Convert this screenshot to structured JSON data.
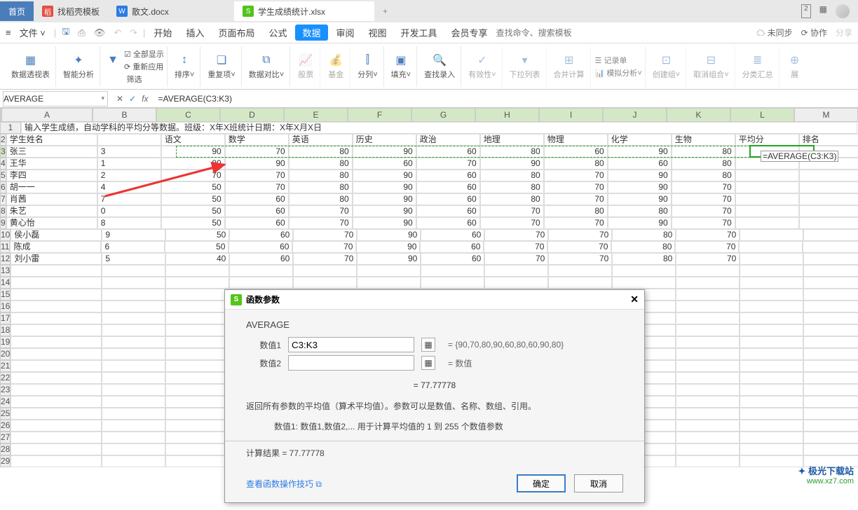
{
  "tabs": {
    "home": "首页",
    "t1": "找稻壳模板",
    "t2": "散文.docx",
    "t3": "学生成绩统计.xlsx"
  },
  "tab_right_square": "2",
  "file_btn": "文件",
  "menu": {
    "kaishi": "开始",
    "charu": "插入",
    "yemian": "页面布局",
    "gongshi": "公式",
    "shuju": "数据",
    "shenyue": "审阅",
    "shitu": "视图",
    "kaifa": "开发工具",
    "huiyuan": "会员专享"
  },
  "search_placeholder": "查找命令、搜索模板",
  "menu_right": {
    "weitongbu": "未同步",
    "xiezuo": "协作",
    "fenxiang": "分享"
  },
  "ribbon": {
    "shujutoushi": "数据透视表",
    "zhinengfenxi": "智能分析",
    "quanbuxianshi": "全部显示",
    "chongxinying": "重新应用",
    "shaixuan": "筛选",
    "paixu": "排序",
    "zhongfuxiang": "重复项",
    "shujaduibi": "数据对比",
    "gupiao": "股票",
    "jijin": "基金",
    "fenie": "分列",
    "tianchong": "填充",
    "chazhaoluru": "查找录入",
    "youxiaoxing": "有效性",
    "xialaliebiao": "下拉列表",
    "hebingjisuan": "合并计算",
    "jilvdan": "记录单",
    "monifenxi": "模拟分析",
    "chuangjianzu": "创建组",
    "quxiaozuhe": "取消组合",
    "fenleihuizong": "分类汇总",
    "zhangkai": "展"
  },
  "name_box": "AVERAGE",
  "formula": "=AVERAGE(C3:K3)",
  "columns": [
    "A",
    "B",
    "C",
    "D",
    "E",
    "F",
    "G",
    "H",
    "I",
    "J",
    "K",
    "L",
    "M"
  ],
  "header1": "输入学生成绩，自动学科的平均分等数据。班级：X年X班统计日期：X年X月X日",
  "header2": [
    "学生姓名",
    "",
    "语文",
    "数学",
    "英语",
    "历史",
    "政治",
    "地理",
    "物理",
    "化学",
    "生物",
    "平均分",
    "排名"
  ],
  "rows": [
    {
      "n": "3",
      "a": "张三",
      "b": "3",
      "v": [
        90,
        70,
        80,
        90,
        60,
        80,
        60,
        90,
        80
      ]
    },
    {
      "n": "4",
      "a": "王华",
      "b": "1",
      "v": [
        80,
        90,
        80,
        60,
        70,
        90,
        80,
        60,
        80
      ]
    },
    {
      "n": "5",
      "a": "李四",
      "b": "2",
      "v": [
        70,
        70,
        80,
        90,
        60,
        80,
        70,
        90,
        80
      ]
    },
    {
      "n": "6",
      "a": "胡一一",
      "b": "4",
      "v": [
        50,
        70,
        80,
        90,
        60,
        80,
        70,
        90,
        70
      ]
    },
    {
      "n": "7",
      "a": "肖茜",
      "b": "7",
      "v": [
        50,
        60,
        80,
        90,
        60,
        80,
        70,
        90,
        70
      ]
    },
    {
      "n": "8",
      "a": "朱艺",
      "b": "0",
      "v": [
        50,
        60,
        70,
        90,
        60,
        70,
        80,
        80,
        70
      ]
    },
    {
      "n": "9",
      "a": "黄心怡",
      "b": "8",
      "v": [
        50,
        60,
        70,
        90,
        60,
        70,
        70,
        90,
        70
      ]
    },
    {
      "n": "10",
      "a": "侯小磊",
      "b": "9",
      "v": [
        50,
        60,
        70,
        90,
        60,
        70,
        70,
        80,
        70
      ]
    },
    {
      "n": "11",
      "a": "陈成",
      "b": "6",
      "v": [
        50,
        60,
        70,
        90,
        60,
        70,
        70,
        80,
        70
      ]
    },
    {
      "n": "12",
      "a": "刘小雷",
      "b": "5",
      "v": [
        40,
        60,
        70,
        90,
        60,
        70,
        70,
        80,
        70
      ]
    }
  ],
  "overlay_formula": "=AVERAGE(C3:K3)",
  "dialog": {
    "title": "函数参数",
    "fname": "AVERAGE",
    "param1_label": "数值1",
    "param1_value": "C3:K3",
    "param1_eval": "= {90,70,80,90,60,80,60,90,80}",
    "param2_label": "数值2",
    "param2_eval": "= 数值",
    "equals": "= 77.77778",
    "desc1": "返回所有参数的平均值（算术平均值）。参数可以是数值、名称、数组、引用。",
    "desc2": "数值1: 数值1,数值2,... 用于计算平均值的 1 到 255 个数值参数",
    "calc": "计算结果 = 77.77778",
    "link": "查看函数操作技巧",
    "ok": "确定",
    "cancel": "取消"
  },
  "watermark": {
    "l1": "极光下载站",
    "l2": "www.xz7.com"
  }
}
